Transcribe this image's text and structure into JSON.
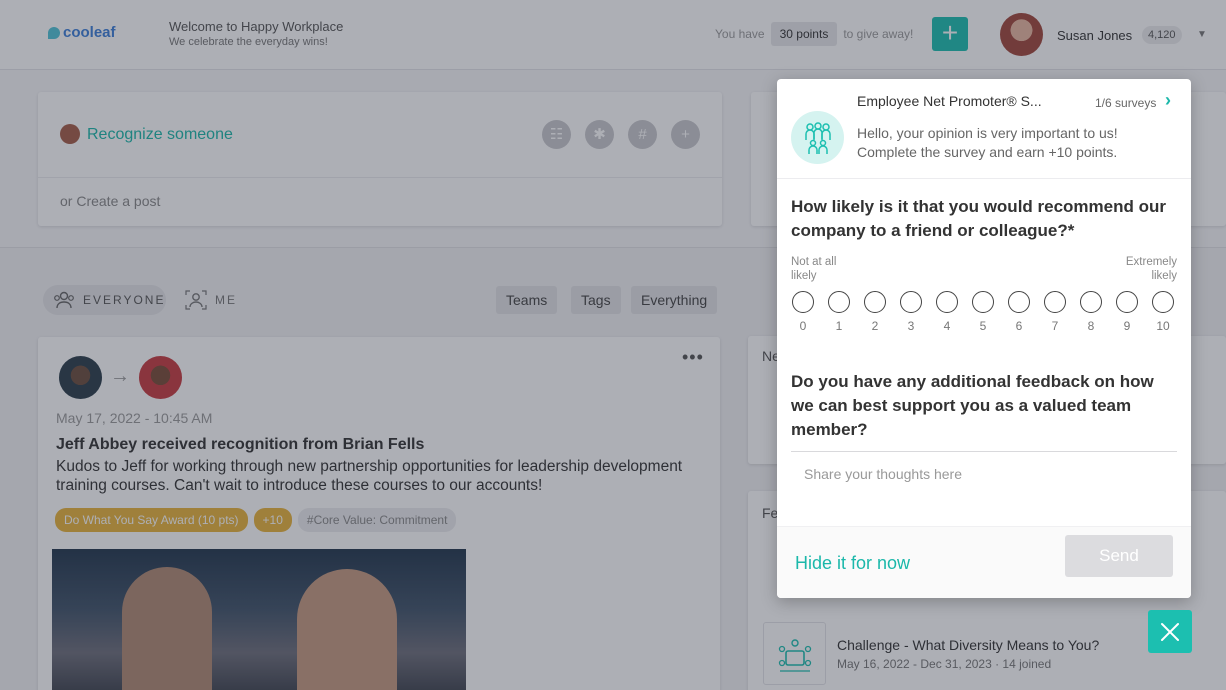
{
  "header": {
    "logo_text": "cooleaf",
    "welcome_title": "Welcome to Happy Workplace",
    "welcome_sub": "We celebrate the everyday wins!",
    "points_prefix": "You have",
    "points_value": "30 points",
    "points_suffix": "to give away!",
    "add_label": "+",
    "user_name": "Susan Jones",
    "user_points": "4,120",
    "accent_color": "#1cbfb0"
  },
  "composer": {
    "recognize_label": "Recognize someone",
    "create_post_label": "or Create a post",
    "tool_icons": [
      "group-icon",
      "asterisk-icon",
      "hashtag-icon",
      "plus-icon"
    ]
  },
  "filters": {
    "everyone": "EVERYONE",
    "me": "ME",
    "chips": [
      "Teams",
      "Tags",
      "Everything"
    ]
  },
  "feed": {
    "date": "May 17, 2022 - 10:45 AM",
    "title": "Jeff Abbey received recognition from Brian Fells",
    "body": "Kudos to Jeff for working through new partnership opportunities for leadership development training courses. Can't wait to introduce these courses to our accounts!",
    "tags": [
      "Do What You Say Award (10 pts)",
      "+10",
      "#Core Value: Commitment"
    ],
    "more_label": "•••"
  },
  "side": {
    "mid_label": "Ne",
    "bottom_label": "Fe",
    "challenge_title": "Challenge - What Diversity Means to You?",
    "challenge_meta": "May 16, 2022 - Dec 31, 2023 · 14 joined"
  },
  "survey": {
    "title": "Employee Net Promoter® S...",
    "count": "1/6 surveys",
    "intro": "Hello, your opinion is very important to us! Complete the survey and earn +10 points.",
    "question1": "How likely is it that you would recommend our company to a friend or colleague?*",
    "scale_low": "Not at all likely",
    "scale_high": "Extremely likely",
    "scale": [
      "0",
      "1",
      "2",
      "3",
      "4",
      "5",
      "6",
      "7",
      "8",
      "9",
      "10"
    ],
    "question2": "Do you have any additional feedback on how we can best support you as a valued team member?",
    "feedback_value": "",
    "feedback_placeholder": "Share your thoughts here",
    "hide_label": "Hide it for now",
    "send_label": "Send"
  }
}
